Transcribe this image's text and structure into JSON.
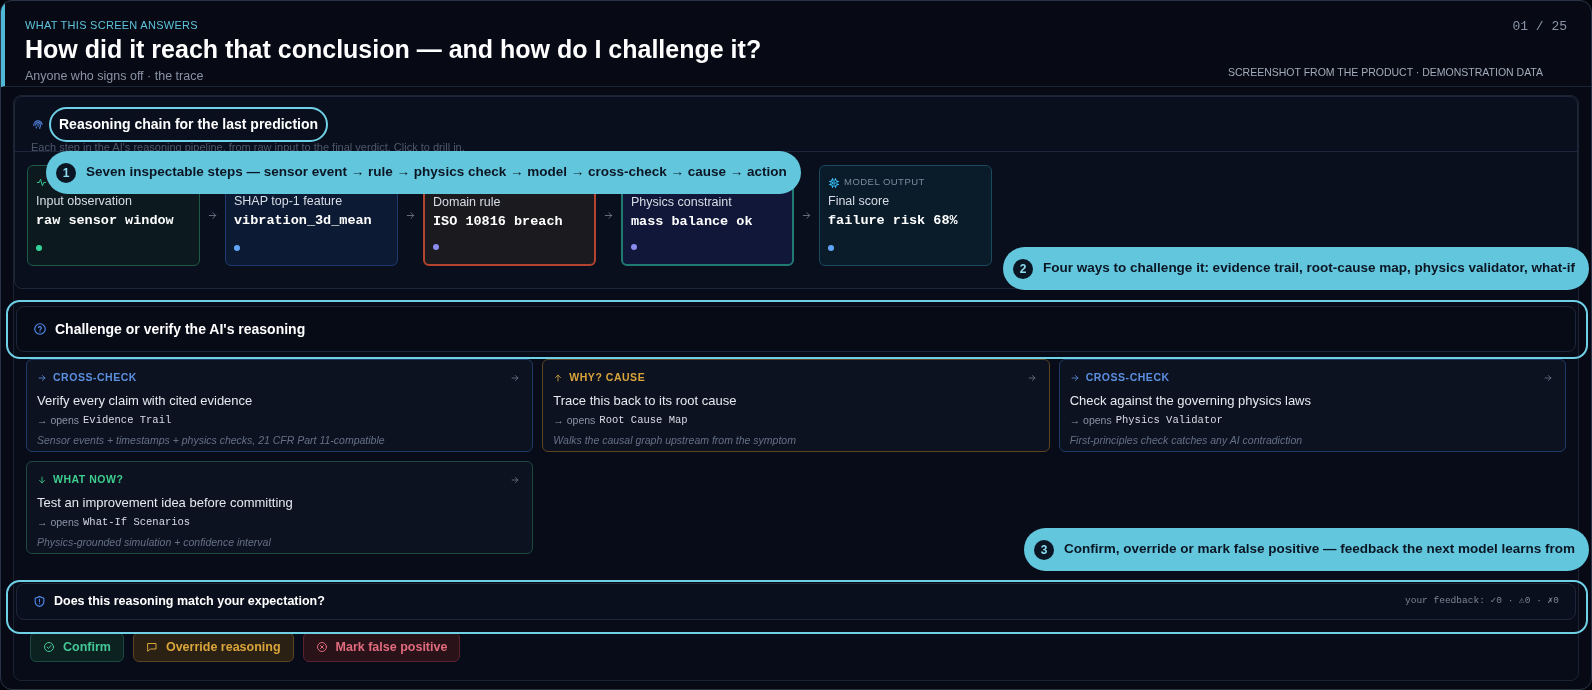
{
  "header": {
    "eyebrow": "WHAT THIS SCREEN ANSWERS",
    "title": "How did it reach that conclusion — and how do I challenge it?",
    "subtitle": "Anyone who signs off · the trace",
    "counter": "01 / 25",
    "note": "SCREENSHOT FROM THE PRODUCT · DEMONSTRATION DATA"
  },
  "reasoning": {
    "title": "Reasoning chain for the last prediction",
    "description": "Each step in the AI's reasoning pipeline, from raw input to the final verdict. Click to drill in.",
    "steps": [
      {
        "kind": "input",
        "name": "Input observation",
        "value": "raw sensor window",
        "color": "#1f5a48"
      },
      {
        "kind": "feature",
        "name": "SHAP top-1 feature",
        "value": "vibration_3d_mean",
        "color": "#1e3a6e"
      },
      {
        "kind": "rule",
        "name": "Domain rule",
        "value": "ISO 10816 breach",
        "color": "#b4432f"
      },
      {
        "kind": "physics",
        "name": "Physics constraint",
        "value": "mass balance ok",
        "color": "#1f7a72"
      },
      {
        "kind": "model",
        "label": "MODEL OUTPUT",
        "name": "Final score",
        "value": "failure risk 68%",
        "color": "#1b4a5e"
      }
    ]
  },
  "challenge": {
    "title": "Challenge or verify the AI's reasoning",
    "cards": [
      {
        "kind": "cross-check",
        "tag": "CROSS-CHECK",
        "title": "Verify every claim with cited evidence",
        "opens": "→ opens",
        "target": "Evidence Trail",
        "note": "Sensor events + timestamps + physics checks, 21 CFR Part 11-compatible"
      },
      {
        "kind": "why",
        "tag": "WHY? CAUSE",
        "title": "Trace this back to its root cause",
        "opens": "→ opens",
        "target": "Root Cause Map",
        "note": "Walks the causal graph upstream from the symptom"
      },
      {
        "kind": "cross-check",
        "tag": "CROSS-CHECK",
        "title": "Check against the governing physics laws",
        "opens": "→ opens",
        "target": "Physics Validator",
        "note": "First-principles check catches any AI contradiction"
      },
      {
        "kind": "what-now",
        "tag": "WHAT NOW?",
        "title": "Test an improvement idea before committing",
        "opens": "→ opens",
        "target": "What-If Scenarios",
        "note": "Physics-grounded simulation + confidence interval"
      }
    ]
  },
  "feedback": {
    "question": "Does this reasoning match your expectation?",
    "tally": "your feedback: ✓0 · ⚠0 · ✗0",
    "buttons": [
      {
        "kind": "confirm",
        "label": "Confirm"
      },
      {
        "kind": "override",
        "label": "Override reasoning"
      },
      {
        "kind": "false-positive",
        "label": "Mark false positive"
      }
    ]
  },
  "callouts": [
    {
      "number": "1",
      "text": "Seven inspectable steps — sensor event → rule → physics check → model → cross-check → cause → action"
    },
    {
      "number": "2",
      "text": "Four ways to challenge it: evidence trail, root-cause map, physics validator, what-if"
    },
    {
      "number": "3",
      "text": "Confirm, override or mark false positive — feedback the next model learns from"
    }
  ]
}
